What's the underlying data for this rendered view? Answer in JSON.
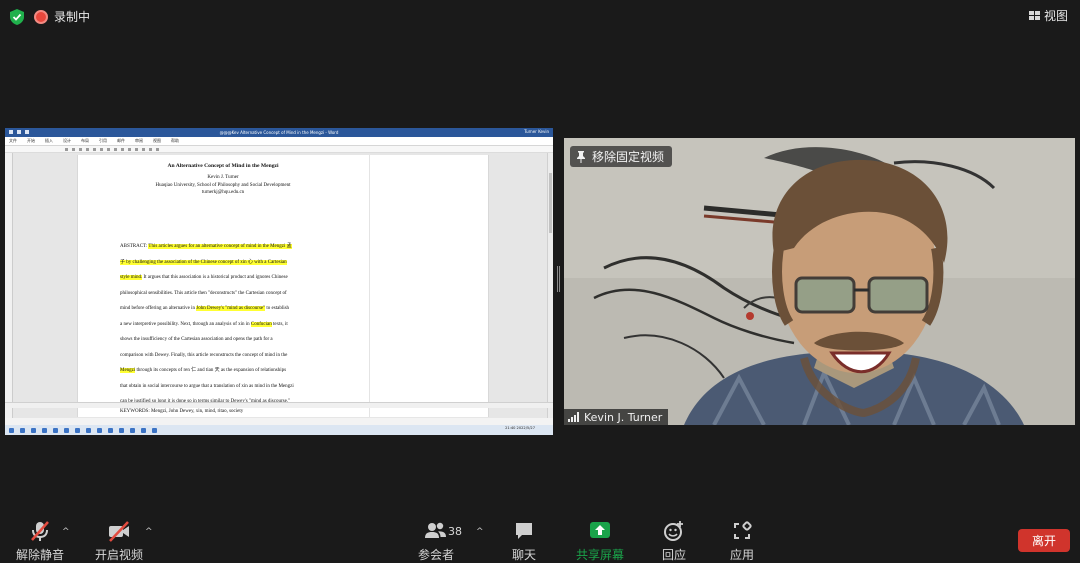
{
  "top": {
    "recording_label": "录制中",
    "view_label": "视图"
  },
  "share": {
    "window_title": "@@@Kev Alternative Concept of Mind in the Mengzi - Word",
    "user": "Turner Kevin",
    "ribbon_tabs": [
      "文件",
      "开始",
      "插入",
      "设计",
      "布局",
      "引用",
      "邮件",
      "审阅",
      "视图",
      "帮助"
    ],
    "doc": {
      "title": "An Alternative Concept of Mind in the Mengzi",
      "author": "Kevin J. Turner",
      "affiliation": "Huaqiao University, School of Philosophy and Social Development",
      "email": "turnerkj@hqu.edu.cn",
      "lines": [
        [
          "ABSTRACT: ",
          "This articles argues for an alternative concept of mind in the Mengzi 孟",
          ""
        ],
        [
          "",
          "子 by challenging the association of the Chinese concept of xin 心 with a Cartesian",
          ""
        ],
        [
          "",
          "style mind.",
          " It argues that this association is a historical product and ignores Chinese"
        ],
        [
          "philosophical sensibilities. This article then \"deconstructs\" the Cartesian concept of",
          "",
          ""
        ],
        [
          "mind before offering an alternative in ",
          "John Dewey's \"mind as discourse\"",
          " to establish"
        ],
        [
          "a new interpretive possibility. Next, through an analysis of xin in ",
          "Confucian",
          " texts, it"
        ],
        [
          "shows the insufficiency of the Cartesian association and opens the path for a",
          "",
          ""
        ],
        [
          "comparison with Dewey. Finally, this article reconstructs the concept of mind in the",
          "",
          ""
        ],
        [
          "",
          "Mengzi",
          " through its concepts of ren 仁 and tian 天 as the expansion of relationships"
        ],
        [
          "that obtain in social intercourse to argue that a translation of xin as mind in the Mengzi",
          "",
          ""
        ],
        [
          "can be justified so long it is done so in terms similar to Dewey's \"mind as discourse.\"",
          "",
          ""
        ]
      ],
      "keywords": "KEYWORDS: Mengzi, John Dewey, xin, mind, ritao, society"
    },
    "clock": "21:40\n2022/5/27"
  },
  "video": {
    "pin_label": "移除固定视频",
    "participant_name": "Kevin J. Turner"
  },
  "controls": {
    "unmute": "解除静音",
    "start_video": "开启视频",
    "participants": "参会者",
    "participants_count": "38",
    "chat": "聊天",
    "share_screen": "共享屏幕",
    "reactions": "回应",
    "apps": "应用",
    "leave": "离开"
  },
  "colors": {
    "share_green": "#1aa34a",
    "leave_red": "#d0342c",
    "highlight": "#ffff33"
  }
}
